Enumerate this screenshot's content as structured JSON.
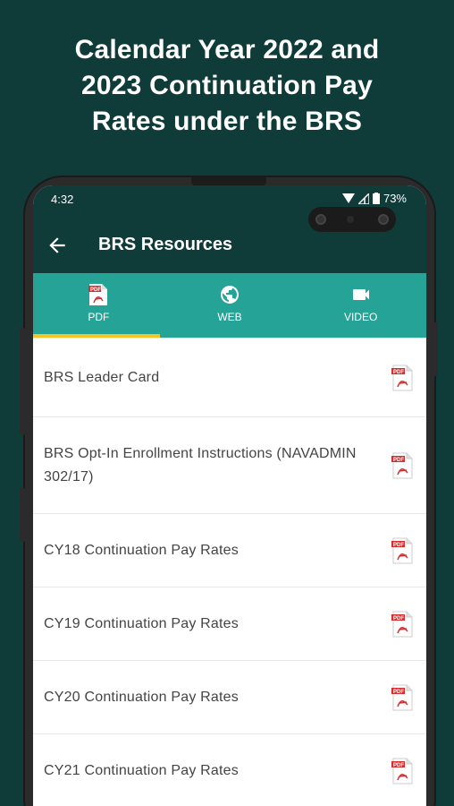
{
  "headline": {
    "line1": "Calendar Year 2022 and",
    "line2": "2023 Continuation Pay",
    "line3": "Rates under the BRS"
  },
  "status_bar": {
    "time": "4:32",
    "battery": "73%"
  },
  "app_bar": {
    "title": "BRS Resources",
    "back_icon": "arrow-back-icon"
  },
  "tabs": [
    {
      "label": "PDF",
      "icon": "pdf-icon",
      "selected": true
    },
    {
      "label": "WEB",
      "icon": "globe-icon",
      "selected": false
    },
    {
      "label": "VIDEO",
      "icon": "video-camera-icon",
      "selected": false
    }
  ],
  "items": [
    {
      "label": "BRS Leader Card"
    },
    {
      "label": "BRS Opt-In Enrollment Instructions (NAVADMIN 302/17)"
    },
    {
      "label": "CY18 Continuation Pay Rates"
    },
    {
      "label": "CY19 Continuation Pay Rates"
    },
    {
      "label": "CY20 Continuation Pay Rates"
    },
    {
      "label": "CY21 Continuation Pay Rates"
    }
  ],
  "colors": {
    "background": "#0f3b38",
    "app_bar": "#0f3b38",
    "tab_bar": "#25a396",
    "tab_indicator": "#f2c52b",
    "pdf_red": "#d32f2f"
  }
}
